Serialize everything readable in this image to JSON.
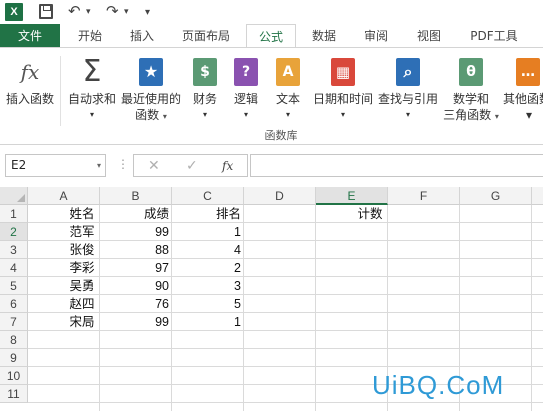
{
  "app": {
    "logo": "X"
  },
  "qat": {
    "undo_glyph": "↶",
    "redo_glyph": "↷",
    "more_glyph": "▾",
    "dropdown_glyph": "▾"
  },
  "tabs": [
    {
      "label": "文件"
    },
    {
      "label": "开始"
    },
    {
      "label": "插入"
    },
    {
      "label": "页面布局"
    },
    {
      "label": "公式"
    },
    {
      "label": "数据"
    },
    {
      "label": "审阅"
    },
    {
      "label": "视图"
    },
    {
      "label": "PDF工具"
    }
  ],
  "ribbon": {
    "insert_function": {
      "icon_text": "fx",
      "label": "插入函数"
    },
    "autosum": {
      "icon_text": "Σ",
      "label": "自动求和"
    },
    "recent": {
      "icon_text": "★",
      "label": "最近使用的",
      "label2": "函数"
    },
    "financial": {
      "icon_text": "$",
      "label": "财务"
    },
    "logical": {
      "icon_text": "?",
      "label": "逻辑"
    },
    "text": {
      "icon_text": "A",
      "label": "文本"
    },
    "datetime": {
      "icon_text": "▦",
      "label": "日期和时间"
    },
    "lookup": {
      "icon_text": "⌕",
      "label": "查找与引用"
    },
    "math": {
      "icon_text": "θ",
      "label": "数学和",
      "label2": "三角函数"
    },
    "other": {
      "icon_text": "…",
      "label": "其他函数"
    },
    "caret": "▾",
    "group_label": "函数库"
  },
  "formula_bar": {
    "name_box": "E2",
    "cancel_glyph": "✕",
    "enter_glyph": "✓",
    "fx_glyph": "fx",
    "dots": "⋮",
    "value": ""
  },
  "columns": [
    "A",
    "B",
    "C",
    "D",
    "E",
    "F",
    "G"
  ],
  "rows": [
    "1",
    "2",
    "3",
    "4",
    "5",
    "6",
    "7",
    "8",
    "9",
    "10",
    "11"
  ],
  "sheet": {
    "headers": {
      "a1": "姓名",
      "b1": "成绩",
      "c1": "排名",
      "e1": "计数"
    },
    "data": [
      {
        "name": "范军",
        "score": "99",
        "rank": "1"
      },
      {
        "name": "张俊",
        "score": "88",
        "rank": "4"
      },
      {
        "name": "李彩",
        "score": "97",
        "rank": "2"
      },
      {
        "name": "吴勇",
        "score": "90",
        "rank": "3"
      },
      {
        "name": "赵四",
        "score": "76",
        "rank": "5"
      },
      {
        "name": "宋局",
        "score": "99",
        "rank": "1"
      }
    ]
  },
  "watermark": "UiBQ.CoM",
  "colors": {
    "excel_green": "#217346",
    "watermark_blue": "#2f9ad6"
  }
}
